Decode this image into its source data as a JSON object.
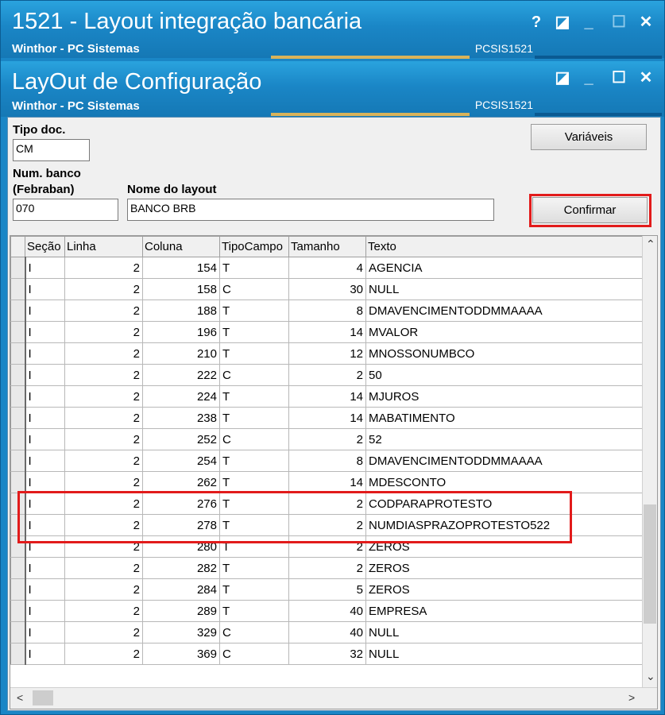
{
  "outer_window": {
    "title": "1521 - Layout integração bancária",
    "subtitle": "Winthor - PC Sistemas",
    "code": "PCSIS1521",
    "buttons": {
      "help": "?",
      "restore": "◪",
      "minimize": "_",
      "maximize": "☐",
      "close": "✕"
    }
  },
  "inner_window": {
    "title": "LayOut de Configuração",
    "subtitle": "Winthor - PC Sistemas",
    "code": "PCSIS1521",
    "buttons": {
      "restore": "◪",
      "minimize": "_",
      "maximize": "☐",
      "close": "✕"
    }
  },
  "form": {
    "tipo_doc_label": "Tipo doc.",
    "tipo_doc_value": "CM",
    "num_banco_label": "Num. banco",
    "num_banco_label2": "(Febraban)",
    "num_banco_value": "070",
    "nome_layout_label": "Nome do layout",
    "nome_layout_value": "BANCO BRB",
    "variaveis_button": "Variáveis",
    "confirmar_button": "Confirmar"
  },
  "grid": {
    "columns": [
      "Seção",
      "Linha",
      "Coluna",
      "TipoCampo",
      "Tamanho",
      "Texto"
    ],
    "rows": [
      [
        "I",
        "2",
        "154",
        "T",
        "4",
        "AGENCIA"
      ],
      [
        "I",
        "2",
        "158",
        "C",
        "30",
        "NULL"
      ],
      [
        "I",
        "2",
        "188",
        "T",
        "8",
        "DMAVENCIMENTODDMMAAAA"
      ],
      [
        "I",
        "2",
        "196",
        "T",
        "14",
        "MVALOR"
      ],
      [
        "I",
        "2",
        "210",
        "T",
        "12",
        "MNOSSONUMBCO"
      ],
      [
        "I",
        "2",
        "222",
        "C",
        "2",
        "50"
      ],
      [
        "I",
        "2",
        "224",
        "T",
        "14",
        "MJUROS"
      ],
      [
        "I",
        "2",
        "238",
        "T",
        "14",
        "MABATIMENTO"
      ],
      [
        "I",
        "2",
        "252",
        "C",
        "2",
        "52"
      ],
      [
        "I",
        "2",
        "254",
        "T",
        "8",
        "DMAVENCIMENTODDMMAAAA"
      ],
      [
        "I",
        "2",
        "262",
        "T",
        "14",
        "MDESCONTO"
      ],
      [
        "I",
        "2",
        "276",
        "T",
        "2",
        "CODPARAPROTESTO"
      ],
      [
        "I",
        "2",
        "278",
        "T",
        "2",
        "NUMDIASPRAZOPROTESTO522"
      ],
      [
        "I",
        "2",
        "280",
        "T",
        "2",
        "ZEROS"
      ],
      [
        "I",
        "2",
        "282",
        "T",
        "2",
        "ZEROS"
      ],
      [
        "I",
        "2",
        "284",
        "T",
        "5",
        "ZEROS"
      ],
      [
        "I",
        "2",
        "289",
        "T",
        "40",
        "EMPRESA"
      ],
      [
        "I",
        "2",
        "329",
        "C",
        "40",
        "NULL"
      ],
      [
        "I",
        "2",
        "369",
        "C",
        "32",
        "NULL"
      ]
    ],
    "scroll_up": "⌃",
    "scroll_down": "⌄",
    "scroll_left": "<",
    "scroll_right": ">"
  },
  "colors": {
    "title_bar": "#1a86c6",
    "highlight": "#e21b1b"
  }
}
